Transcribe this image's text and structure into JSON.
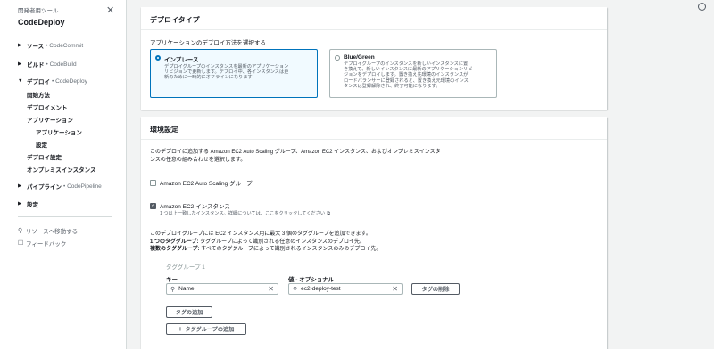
{
  "sidebar": {
    "tool_label": "開発者用ツール",
    "title": "CodeDeploy",
    "sections": [
      {
        "label": "ソース",
        "sub": "• CodeCommit"
      },
      {
        "label": "ビルド",
        "sub": "• CodeBuild"
      },
      {
        "label": "デプロイ",
        "sub": "• CodeDeploy"
      },
      {
        "label": "パイプライン",
        "sub": "• CodePipeline"
      },
      {
        "label": "設定",
        "sub": ""
      }
    ],
    "deploy_children": [
      "開始方法",
      "デプロイメント",
      "アプリケーション",
      "アプリケーション",
      "設定",
      "デプロイ設定",
      "オンプレミスインスタンス"
    ],
    "utilities": [
      "リソースへ移動する",
      "フィードバック"
    ]
  },
  "deploy_type": {
    "heading": "デプロイタイプ",
    "prompt": "アプリケーションのデプロイ方法を選択する",
    "options": [
      {
        "title": "インプレース",
        "desc": [
          "デプロイグループのインスタンスを最新のアプリケーション",
          "リビジョンで更新します。デプロイ中、各インスタンスは更",
          "新のために一時的にオフラインになります"
        ],
        "selected": true
      },
      {
        "title": "Blue/Green",
        "desc": [
          "デプロイグループのインスタンスを新しいインスタンスに置",
          "き換えて、新しいインスタンスに最新のアプリケーションリビ",
          "ジョンをデプロイします。置き換え先環境のインスタンスが",
          "ロードバランサーに登録されると、置き換え元環境のインス",
          "タンスは登録解除され、終了可能になります。"
        ],
        "selected": false
      }
    ]
  },
  "environment": {
    "heading": "環境設定",
    "intro": [
      "このデプロイに追加する Amazon EC2 Auto Scaling グループ、Amazon EC2 インスタンス、およびオンプレミスインスタ",
      "ンスの任意の組み合わせを選択します。"
    ],
    "asg_checkbox": {
      "label": "Amazon EC2 Auto Scaling グループ",
      "checked": false
    },
    "ec2_checkbox": {
      "label": "Amazon EC2 インスタンス",
      "checked": true,
      "hint": "1 つ以上一致したインスタンス。詳細については、ここをクリックしてください"
    },
    "tag_info": {
      "line1": "このデプロイグループには EC2 インスタンス用に最大 3 個のタググループを追加できます。",
      "one_bold": "1 つのタググループ:",
      "one_rest": " タググループによって識別される任意のインスタンスのデプロイ先。",
      "multi_bold": "複数のタググループ:",
      "multi_rest": " すべてのタググループによって識別されるインスタンスのみのデプロイ先。"
    },
    "tag_group_label": "タググループ 1",
    "key_label": "キー",
    "key_value": "Name",
    "value_label": "値 - オプショナル",
    "value_value": "ec2-deploy-test",
    "remove_tag_button": "タグの削除",
    "add_tag_button": "タグの追加",
    "add_group_button": "タググループの追加"
  },
  "info_icon_label": "i"
}
